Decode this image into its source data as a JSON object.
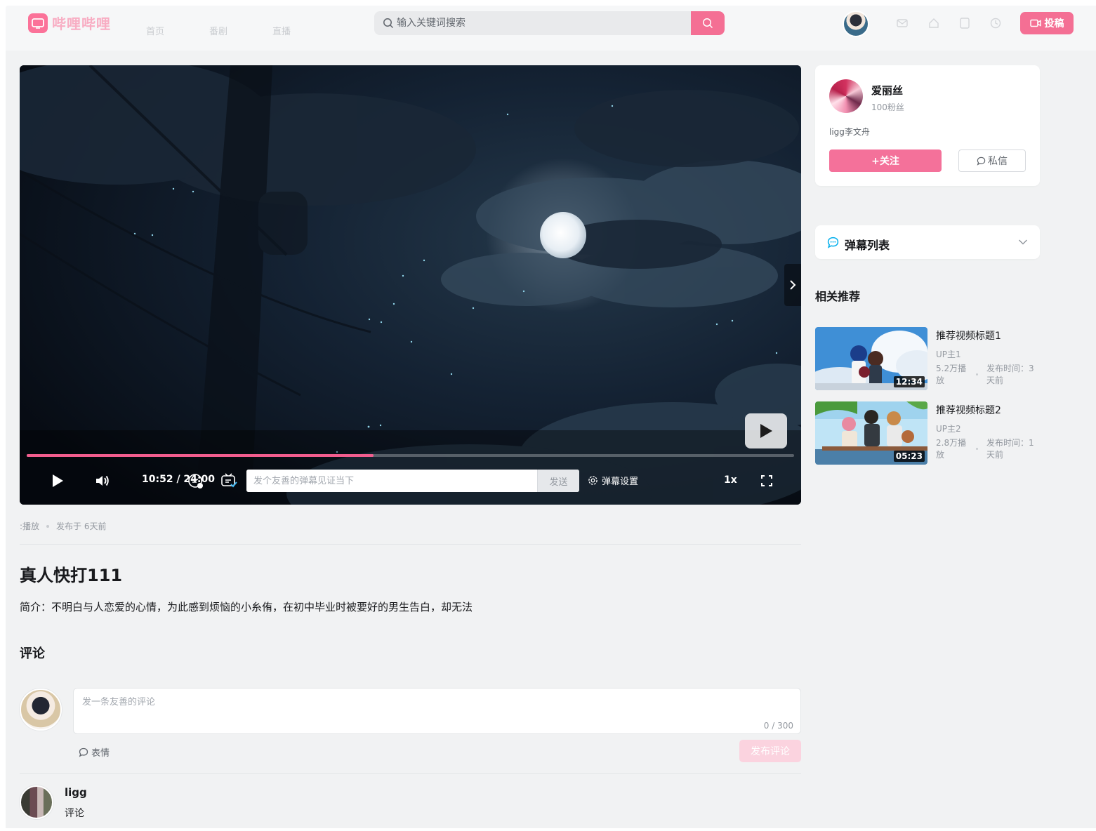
{
  "header": {
    "logo_text": "哔哩哔哩",
    "nav": [
      "首页",
      "番剧",
      "直播"
    ],
    "search_placeholder": "输入关键词搜索",
    "upload_label": "投稿"
  },
  "player": {
    "current_time": "10:52",
    "duration": "24:00",
    "time_display": "10:52 / 24:00",
    "progress_percent": 45.2,
    "buffer_percent": 45.2,
    "danmaku_placeholder": "发个友善的弹幕见证当下",
    "send_label": "发送",
    "danmaku_settings_label": "弹幕设置",
    "speed_label": "1x"
  },
  "video": {
    "plays_label": ":播放",
    "published_label": "发布于 6天前",
    "title": "真人快打111",
    "description": "简介：不明白与人恋爱的心情，为此感到烦恼的小糸侑，在初中毕业时被要好的男生告白，却无法"
  },
  "comments": {
    "heading": "评论",
    "input_placeholder": "发一条友善的评论",
    "char_count": "0 / 300",
    "emoji_label": "表情",
    "submit_label": "发布评论",
    "items": [
      {
        "user": "ligg",
        "text": "评论"
      }
    ]
  },
  "uploader": {
    "name": "爱丽丝",
    "fans": "100粉丝",
    "signature": "ligg李文舟",
    "follow_label": "+关注",
    "message_label": "私信"
  },
  "danmaku_list": {
    "label": "弹幕列表"
  },
  "related": {
    "heading": "相关推荐",
    "items": [
      {
        "title": "推荐视频标题1",
        "up": "UP主1",
        "plays": "5.2万播放",
        "date": "发布时间：3天前",
        "duration": "12:34"
      },
      {
        "title": "推荐视频标题2",
        "up": "UP主2",
        "plays": "2.8万播放",
        "date": "发布时间：1天前",
        "duration": "05:23"
      }
    ]
  },
  "colors": {
    "accent": "#fb7299",
    "background": "#f1f2f3"
  },
  "icons": [
    "tv-logo-icon",
    "search-icon",
    "mail-icon",
    "home-icon",
    "bookmark-icon",
    "history-icon",
    "video-camera-icon",
    "play-icon",
    "volume-icon",
    "danmaku-toggle-icon",
    "gear-icon",
    "fullscreen-icon",
    "chevron-right-icon",
    "chevron-down-icon",
    "chat-bubble-icon"
  ]
}
